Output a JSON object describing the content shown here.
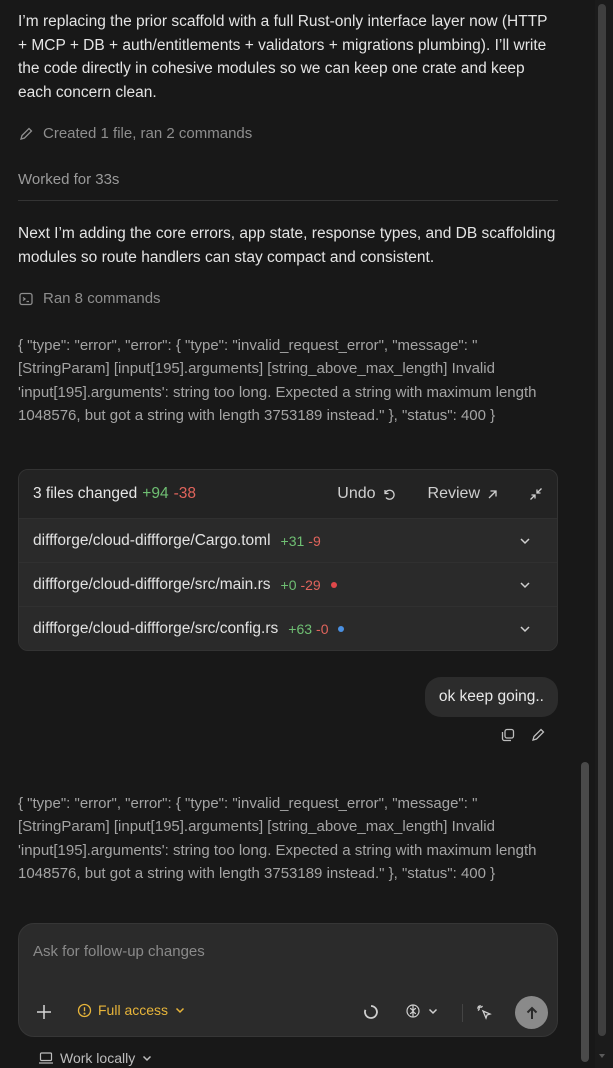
{
  "messages": {
    "intro": "I’m replacing the prior scaffold with a full Rust-only interface layer now (HTTP + MCP + DB + auth/entitlements + validators + migrations plumbing). I’ll write the code directly in cohesive modules so we can keep one crate and keep each concern clean.",
    "created_summary": "Created 1 file, ran 2 commands",
    "worked_for": "Worked for 33s",
    "next_step": "Next I’m adding the core errors, app state, response types, and DB scaffolding modules so route handlers can stay compact and consistent.",
    "ran_summary": "Ran 8 commands",
    "error_1": "{ \"type\": \"error\", \"error\": { \"type\": \"invalid_request_error\", \"message\": \"[StringParam] [input[195].arguments] [string_above_max_length] Invalid 'input[195].arguments': string too long. Expected a string with maximum length 1048576, but got a string with length 3753189 instead.\" }, \"status\": 400 }",
    "user_reply": "ok keep going..",
    "error_2": "{ \"type\": \"error\", \"error\": { \"type\": \"invalid_request_error\", \"message\": \"[StringParam] [input[195].arguments] [string_above_max_length] Invalid 'input[195].arguments': string too long. Expected a string with maximum length 1048576, but got a string with length 3753189 instead.\" }, \"status\": 400 }"
  },
  "changes": {
    "title": "3 files changed",
    "additions": "+94",
    "deletions": "-38",
    "undo_label": "Undo",
    "review_label": "Review",
    "files": [
      {
        "path": "diffforge/cloud-diffforge/Cargo.toml",
        "add": "+31",
        "del": "-9",
        "dot": ""
      },
      {
        "path": "diffforge/cloud-diffforge/src/main.rs",
        "add": "+0",
        "del": "-29",
        "dot": "#e0484a"
      },
      {
        "path": "diffforge/cloud-diffforge/src/config.rs",
        "add": "+63",
        "del": "-0",
        "dot": "#4a90e2"
      }
    ]
  },
  "composer": {
    "placeholder": "Ask for follow-up changes",
    "access_label": "Full access",
    "work_label": "Work locally"
  },
  "colors": {
    "background": "#181818",
    "addition": "#6fbf73",
    "deletion": "#e0645c",
    "access": "#e8b53a"
  }
}
